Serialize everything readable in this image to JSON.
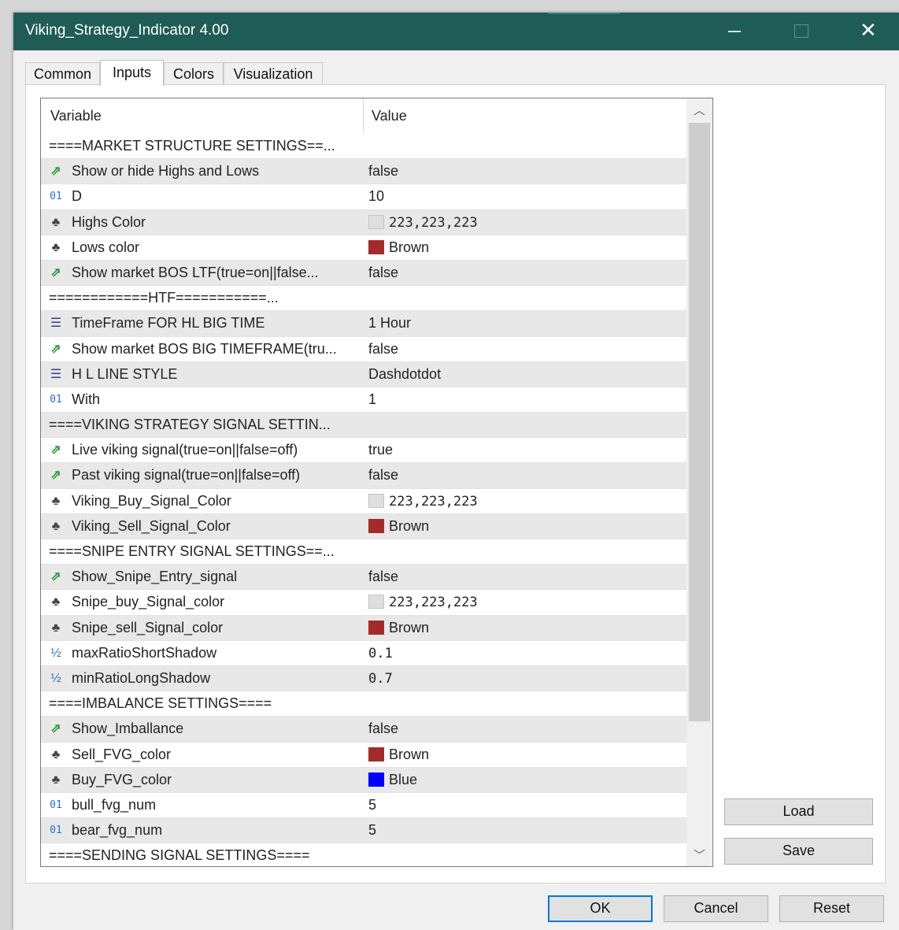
{
  "window": {
    "title": "Viking_Strategy_Indicator 4.00"
  },
  "tabs": [
    {
      "label": "Common"
    },
    {
      "label": "Inputs"
    },
    {
      "label": "Colors"
    },
    {
      "label": "Visualization"
    }
  ],
  "grid": {
    "columns": {
      "variable": "Variable",
      "value": "Value"
    },
    "rows": [
      {
        "icon": "",
        "name": "====MARKET STRUCTURE SETTINGS==...",
        "value": ""
      },
      {
        "icon": "bool",
        "name": "Show or hide Highs and Lows",
        "value": "false"
      },
      {
        "icon": "int",
        "name": "D",
        "value": "10"
      },
      {
        "icon": "color",
        "name": "Highs Color",
        "value": "223,223,223",
        "swatch": "#dfdfdf"
      },
      {
        "icon": "color",
        "name": "Lows color",
        "value": "Brown",
        "swatch": "#a52a2a"
      },
      {
        "icon": "bool",
        "name": "Show market BOS LTF(true=on||false...",
        "value": "false"
      },
      {
        "icon": "",
        "name": "============HTF===========...",
        "value": ""
      },
      {
        "icon": "enum",
        "name": "TimeFrame FOR HL BIG TIME",
        "value": "1 Hour"
      },
      {
        "icon": "bool",
        "name": "Show market BOS BIG TIMEFRAME(tru...",
        "value": "false"
      },
      {
        "icon": "enum",
        "name": "H L LINE STYLE",
        "value": "Dashdotdot"
      },
      {
        "icon": "int",
        "name": "With",
        "value": "1"
      },
      {
        "icon": "",
        "name": "====VIKING STRATEGY SIGNAL SETTIN...",
        "value": ""
      },
      {
        "icon": "bool",
        "name": "Live viking signal(true=on||false=off)",
        "value": "true"
      },
      {
        "icon": "bool",
        "name": "Past viking signal(true=on||false=off)",
        "value": "false"
      },
      {
        "icon": "color",
        "name": "Viking_Buy_Signal_Color",
        "value": "223,223,223",
        "swatch": "#dfdfdf"
      },
      {
        "icon": "color",
        "name": "Viking_Sell_Signal_Color",
        "value": "Brown",
        "swatch": "#a52a2a"
      },
      {
        "icon": "",
        "name": "====SNIPE ENTRY SIGNAL SETTINGS==...",
        "value": ""
      },
      {
        "icon": "bool",
        "name": "Show_Snipe_Entry_signal",
        "value": "false"
      },
      {
        "icon": "color",
        "name": "Snipe_buy_Signal_color",
        "value": "223,223,223",
        "swatch": "#dfdfdf"
      },
      {
        "icon": "color",
        "name": "Snipe_sell_Signal_color",
        "value": "Brown",
        "swatch": "#a52a2a"
      },
      {
        "icon": "double",
        "name": "maxRatioShortShadow",
        "value": "0.1"
      },
      {
        "icon": "double",
        "name": "minRatioLongShadow",
        "value": "0.7"
      },
      {
        "icon": "",
        "name": "====IMBALANCE SETTINGS====",
        "value": ""
      },
      {
        "icon": "bool",
        "name": "Show_Imballance",
        "value": "false"
      },
      {
        "icon": "color",
        "name": "Sell_FVG_color",
        "value": "Brown",
        "swatch": "#a52a2a"
      },
      {
        "icon": "color",
        "name": "Buy_FVG_color",
        "value": "Blue",
        "swatch": "#0000ff"
      },
      {
        "icon": "int",
        "name": "bull_fvg_num",
        "value": "5"
      },
      {
        "icon": "int",
        "name": "bear_fvg_num",
        "value": "5"
      },
      {
        "icon": "",
        "name": "====SENDING SIGNAL SETTINGS====",
        "value": ""
      }
    ]
  },
  "buttons": {
    "load": "Load",
    "save": "Save",
    "ok": "OK",
    "cancel": "Cancel",
    "reset": "Reset"
  }
}
